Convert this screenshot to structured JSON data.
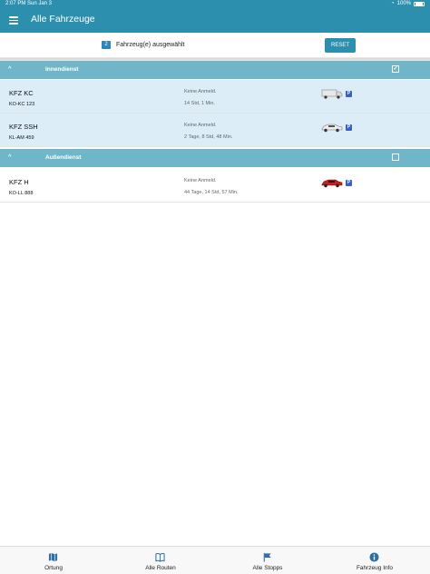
{
  "status_bar": {
    "time": "2:07 PM",
    "date": "Sun Jan 3",
    "battery": "100%"
  },
  "header": {
    "title": "Alle Fahrzeuge"
  },
  "selection": {
    "count": "2",
    "text": "Fahrzeug(e) ausgewählt",
    "reset_label": "RESET"
  },
  "groups": [
    {
      "name": "Innendienst",
      "checked": true,
      "vehicles": [
        {
          "name": "KFZ KC",
          "plate": "KO-KC 123",
          "status": "Keine Anmeld.",
          "duration": "14 Std, 1 Min.",
          "vehicle_icon": "white-van-icon",
          "selected": true
        },
        {
          "name": "KFZ SSH",
          "plate": "KL-AM 459",
          "status": "Keine Anmeld.",
          "duration": "2 Tage, 8 Std, 48 Min.",
          "vehicle_icon": "white-car-icon",
          "selected": true
        }
      ]
    },
    {
      "name": "Außendienst",
      "checked": false,
      "vehicles": [
        {
          "name": "KFZ H",
          "plate": "KO-LL 888",
          "status": "Keine Anmeld.",
          "duration": "44 Tage, 14 Std, 57 Min.",
          "vehicle_icon": "red-car-icon",
          "selected": false
        }
      ]
    }
  ],
  "parking_badge": "P",
  "tabs": [
    {
      "label": "Ortung",
      "icon": "map-icon"
    },
    {
      "label": "Alle Routen",
      "icon": "book-icon"
    },
    {
      "label": "Alle Stopps",
      "icon": "flag-icon"
    },
    {
      "label": "Fahrzeug Info",
      "icon": "info-icon"
    }
  ],
  "colors": {
    "accent": "#2d8fae",
    "group_header": "#6fb6c8",
    "selected_row": "#dcedf8",
    "tab_icon": "#2f6fa8"
  }
}
